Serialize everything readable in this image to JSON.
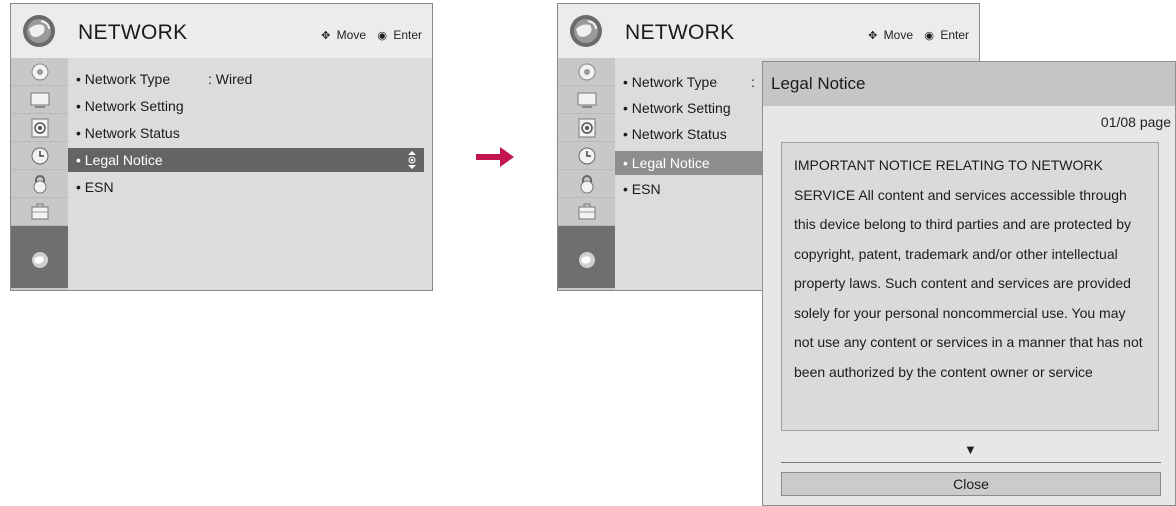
{
  "left_menu": {
    "title": "NETWORK",
    "hints": {
      "move_icon": "four-way-arrow-icon",
      "move": "Move",
      "enter_icon": "circle-dot-icon",
      "enter": "Enter"
    },
    "items": [
      {
        "label": "• Network Type",
        "value": ": Wired"
      },
      {
        "label": "• Network Setting"
      },
      {
        "label": "• Network Status"
      },
      {
        "label": "• Legal Notice"
      },
      {
        "label": "• ESN"
      }
    ],
    "selected_index": 3
  },
  "right_menu": {
    "title": "NETWORK",
    "hints": {
      "move": "Move",
      "enter": "Enter"
    },
    "items": [
      {
        "label": "• Network Type",
        "value": ":"
      },
      {
        "label": "• Network Setting"
      },
      {
        "label": "• Network Status"
      },
      {
        "label": "• Legal Notice"
      },
      {
        "label": "• ESN"
      }
    ]
  },
  "sidebar_icons": [
    "satellite-dish-icon",
    "tv-screen-icon",
    "speaker-icon",
    "clock-icon",
    "lock-icon",
    "toolbox-icon",
    "network-globe-icon"
  ],
  "transition_arrow_color": "#c3164e",
  "dialog": {
    "title": "Legal Notice",
    "page": "01/08 page",
    "body": "IMPORTANT NOTICE RELATING TO NETWORK SERVICE All content and services accessible through this device belong to third parties and are protected by copyright, patent, trademark and/or other intellectual property laws. Such content and services are provided solely for your personal noncommercial use. You may  not use any content or services in a manner that has not been authorized by the content owner or service",
    "scroll_down_icon": "▼",
    "close_label": "Close"
  }
}
